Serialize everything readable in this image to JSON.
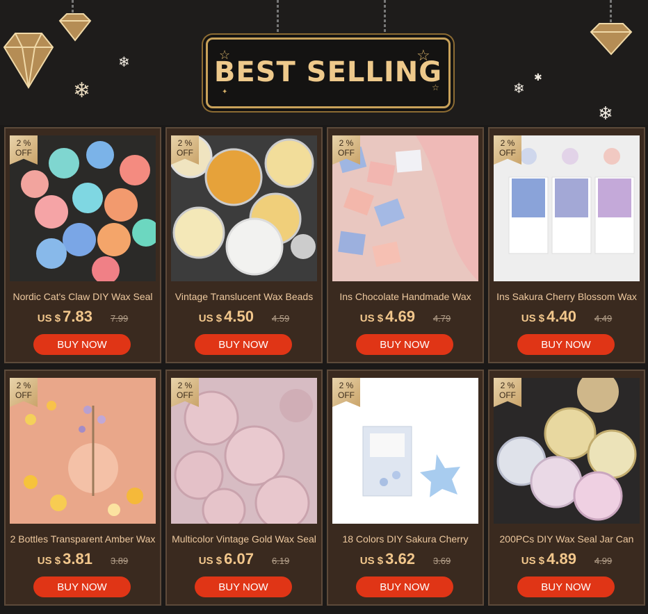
{
  "banner": {
    "title": "BEST SELLING"
  },
  "colors": {
    "background": "#1b1918",
    "card": "#3a2a1f",
    "gold": "#eec98b",
    "button": "#e03516"
  },
  "button_label": "BUY NOW",
  "products": [
    {
      "badge_pct": "2 %",
      "badge_off": "OFF",
      "name": "Nordic Cat's Claw DIY Wax Seal",
      "currency": "US $",
      "price": "7.83",
      "old_price": "7.99"
    },
    {
      "badge_pct": "2 %",
      "badge_off": "OFF",
      "name": "Vintage Translucent Wax Beads",
      "currency": "US $",
      "price": "4.50",
      "old_price": "4.59"
    },
    {
      "badge_pct": "2 %",
      "badge_off": "OFF",
      "name": "Ins Chocolate Handmade Wax",
      "currency": "US $",
      "price": "4.69",
      "old_price": "4.79"
    },
    {
      "badge_pct": "2 %",
      "badge_off": "OFF",
      "name": "Ins Sakura Cherry Blossom Wax",
      "currency": "US $",
      "price": "4.40",
      "old_price": "4.49"
    },
    {
      "badge_pct": "2 %",
      "badge_off": "OFF",
      "name": "2 Bottles Transparent Amber Wax",
      "currency": "US $",
      "price": "3.81",
      "old_price": "3.89"
    },
    {
      "badge_pct": "2 %",
      "badge_off": "OFF",
      "name": "Multicolor Vintage Gold Wax Seal",
      "currency": "US $",
      "price": "6.07",
      "old_price": "6.19"
    },
    {
      "badge_pct": "2 %",
      "badge_off": "OFF",
      "name": "18 Colors DIY Sakura Cherry",
      "currency": "US $",
      "price": "3.62",
      "old_price": "3.69"
    },
    {
      "badge_pct": "2 %",
      "badge_off": "OFF",
      "name": "200PCs DIY Wax Seal Jar Can",
      "currency": "US $",
      "price": "4.89",
      "old_price": "4.99"
    }
  ]
}
